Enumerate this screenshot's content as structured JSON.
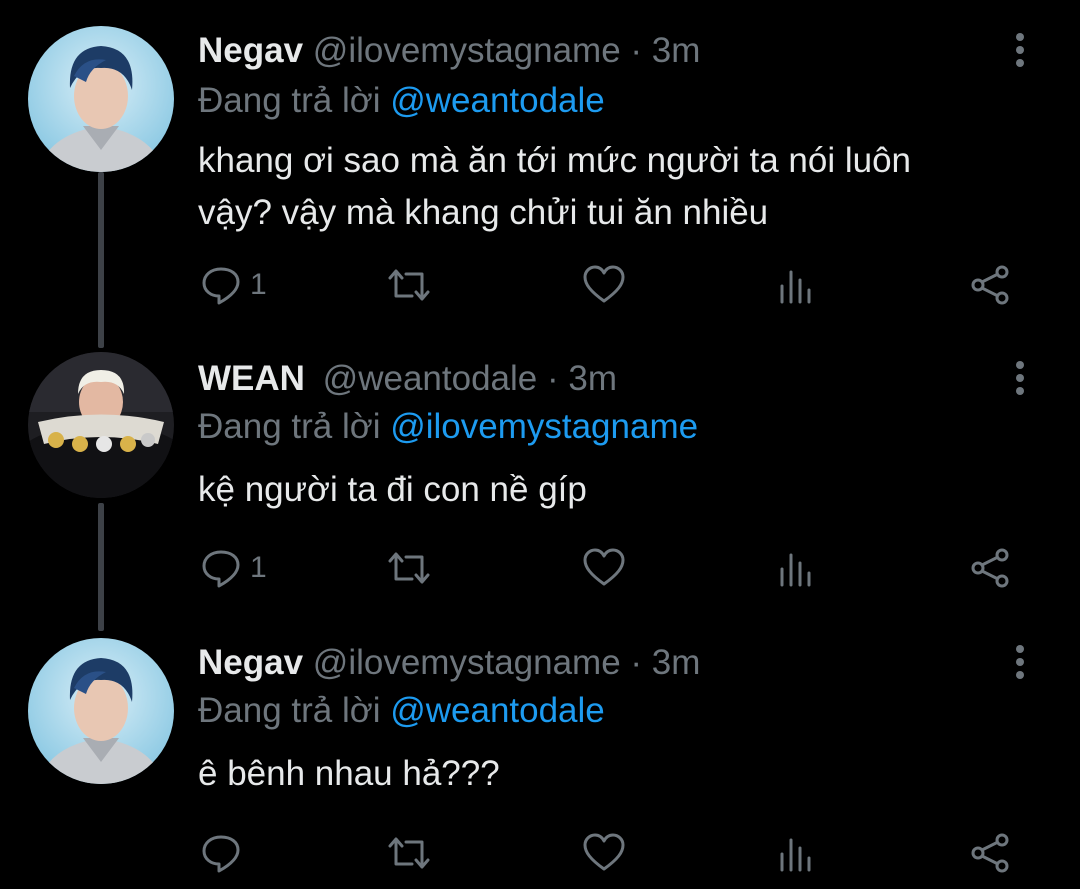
{
  "theme": {
    "background": "#000000",
    "text": "#e7e9ea",
    "muted": "#6e767d",
    "accent": "#1d9bf0",
    "thread_line": "#3d4147"
  },
  "tweets": [
    {
      "display_name": "Negav",
      "handle": "@ilovemystagname",
      "dot": "·",
      "time": "3m",
      "replying_prefix": "Đang trả lời",
      "replying_to": "@weantodale",
      "text_lines": [
        "khang ơi sao mà ăn tới mức người ta nói luôn",
        "vậy? vậy mà khang chửi tui ăn nhiều"
      ],
      "reply_count": "1",
      "avatar_icon": "person-avatar-icon"
    },
    {
      "display_name": "WEAN",
      "handle": "@weantodale",
      "dot": "·",
      "time": "3m",
      "replying_prefix": "Đang trả lời",
      "replying_to": "@ilovemystagname",
      "text_lines": [
        "kệ người ta đi con nề gíp"
      ],
      "reply_count": "1",
      "avatar_icon": "person-avatar-icon"
    },
    {
      "display_name": "Negav",
      "handle": "@ilovemystagname",
      "dot": "·",
      "time": "3m",
      "replying_prefix": "Đang trả lời",
      "replying_to": "@weantodale",
      "text_lines": [
        "ê bênh nhau hả???"
      ],
      "reply_count": "",
      "avatar_icon": "person-avatar-icon"
    }
  ],
  "icons": {
    "reply": "reply-icon",
    "retweet": "retweet-icon",
    "like": "heart-icon",
    "analytics": "analytics-icon",
    "share": "share-icon",
    "more": "more-vertical-icon"
  }
}
